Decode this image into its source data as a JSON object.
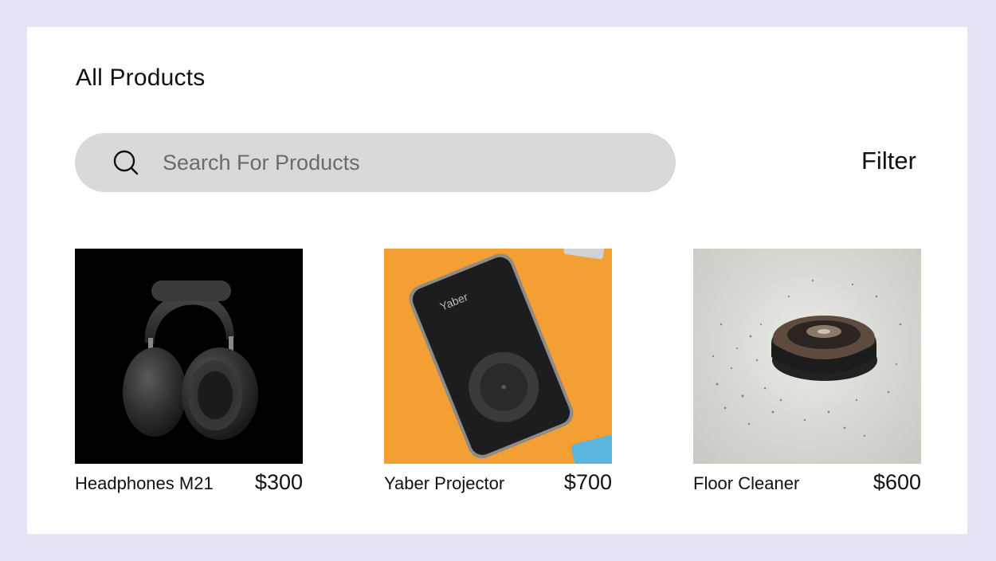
{
  "page": {
    "title": "All Products"
  },
  "search": {
    "placeholder": "Search For Products",
    "value": ""
  },
  "filter": {
    "label": "Filter"
  },
  "products": [
    {
      "name": "Headphones M21",
      "price": "$300",
      "image": "headphones-image"
    },
    {
      "name": "Yaber Projector",
      "price": "$700",
      "image": "projector-image",
      "brand_text": "Yaber"
    },
    {
      "name": "Floor Cleaner",
      "price": "$600",
      "image": "robot-vacuum-image"
    }
  ],
  "colors": {
    "outer_background": "#e8e3f8",
    "panel": "#ffffff",
    "search_background": "#d9d9d9",
    "projector_background": "#f39f33"
  }
}
